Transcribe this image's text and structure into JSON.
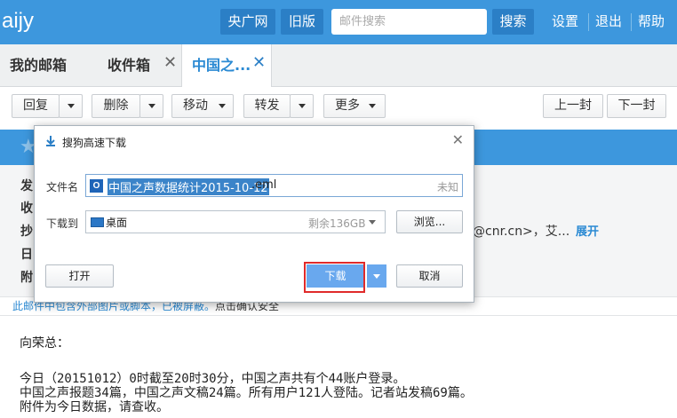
{
  "topbar": {
    "logo": "aijy",
    "btn_cnr": "央广网",
    "btn_old": "旧版",
    "search_placeholder": "邮件搜索",
    "search_button": "搜索",
    "settings": "设置",
    "logout": "退出",
    "help": "帮助",
    "bg_color": "#3d97dd"
  },
  "tabs": [
    {
      "label": "我的邮箱",
      "active": false
    },
    {
      "label": "收件箱",
      "active": false
    },
    {
      "label": "中国之...",
      "active": true
    }
  ],
  "toolbar": {
    "reply": "回复",
    "delete": "删除",
    "move": "移动",
    "forward": "转发",
    "more": "更多",
    "prev": "上一封",
    "next": "下一封"
  },
  "mail_meta": {
    "labels": [
      "发",
      "收",
      "抄",
      "日",
      "附"
    ],
    "cc_tail": "@cnr.cn>，艾...",
    "expand": "展开"
  },
  "warning": {
    "text": "此邮件中包含外部图片或脚本，已被屏蔽。",
    "link": "点击确认安全"
  },
  "body": {
    "greeting": "向荣总：",
    "line1": "今日（20151012）0时截至20时30分，中国之声共有个44账户登录。",
    "line2": "中国之声报题34篇，中国之声文稿24篇。所有用户121人登陆。记者站发稿69篇。",
    "line3": "附件为今日数据，请查收。"
  },
  "dialog": {
    "title": "搜狗高速下载",
    "filename_label": "文件名",
    "filename_selected": "中国之声数据统计2015-10-12",
    "filename_ext": ".eml",
    "size": "未知",
    "saveto_label": "下载到",
    "directory": "桌面",
    "free_space": "剩余136GB",
    "browse": "浏览...",
    "open": "打开",
    "download": "下载",
    "cancel": "取消"
  }
}
